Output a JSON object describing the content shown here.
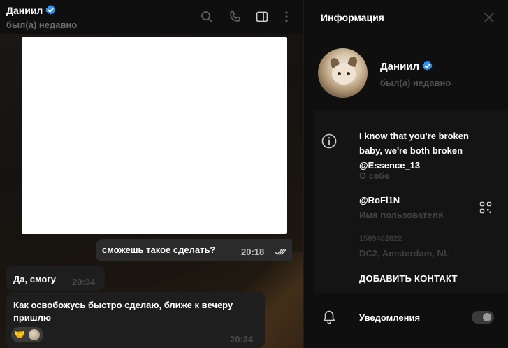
{
  "chat": {
    "contact_name": "Даниил",
    "contact_status": "был(а) недавно",
    "messages": [
      {
        "direction": "out",
        "text": "сможешь такое сделать?",
        "time": "20:18",
        "read": true
      },
      {
        "direction": "in",
        "text": "Да, смогу",
        "time": "20:34"
      },
      {
        "direction": "in",
        "text": "Как освобожусь быстро сделаю, ближе к вечеру пришлю",
        "time": "20:34",
        "reaction": "🤝"
      }
    ]
  },
  "header_icons": [
    "search-icon",
    "phone-icon",
    "sidebar-toggle-icon",
    "more-vertical-icon"
  ],
  "info": {
    "title": "Информация",
    "name": "Даниил",
    "status": "был(а) недавно",
    "bio": "I know that you're broken baby, we're both broken @Essence_13",
    "bio_label": "О себе",
    "username": "@RoFl1N",
    "username_label": "Имя пользователя",
    "phone": "1589462822",
    "dc": "DC2, Amsterdam, NL",
    "add_contact": "ДОБАВИТЬ КОНТАКТ",
    "notifications_label": "Уведомления",
    "notifications_on": true
  },
  "colors": {
    "verify_badge": "#3390ec",
    "background": "#0f0f0f",
    "bubble_out": "#2b2b2b",
    "bubble_in": "#1e1e1e",
    "muted_text": "#6b6b6b"
  }
}
